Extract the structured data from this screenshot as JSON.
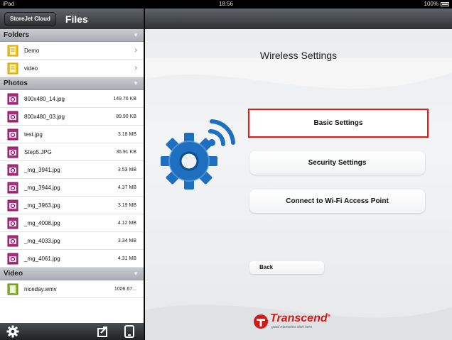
{
  "status_bar": {
    "device": "iPad",
    "time": "18:56",
    "battery": "100%"
  },
  "left_nav": {
    "back_label": "StoreJet Cloud",
    "title": "Files"
  },
  "sections": {
    "folders": "Folders",
    "photos": "Photos",
    "video": "Video"
  },
  "folders": [
    {
      "name": "Demo"
    },
    {
      "name": "video"
    }
  ],
  "photos": [
    {
      "name": "800x480_14.jpg",
      "size": "149.76 KB"
    },
    {
      "name": "800x480_03.jpg",
      "size": "89.90 KB"
    },
    {
      "name": "test.jpg",
      "size": "3.18 MB"
    },
    {
      "name": "Step5.JPG",
      "size": "36.91 KB"
    },
    {
      "name": "_mg_3941.jpg",
      "size": "3.53 MB"
    },
    {
      "name": "_mg_3944.jpg",
      "size": "4.37 MB"
    },
    {
      "name": "_mg_3963.jpg",
      "size": "3.19 MB"
    },
    {
      "name": "_mg_4008.jpg",
      "size": "4.12 MB"
    },
    {
      "name": "_mg_4033.jpg",
      "size": "3.34 MB"
    },
    {
      "name": "_mg_4061.jpg",
      "size": "4.31 MB"
    }
  ],
  "videos": [
    {
      "name": "niceday.wmv",
      "size": "1006.67..."
    }
  ],
  "toolbar_icons": [
    "gear-icon",
    "upload-icon",
    "device-icon"
  ],
  "main": {
    "title": "Wireless Settings",
    "basic_settings": "Basic Settings",
    "security_settings": "Security Settings",
    "connect_wifi": "Connect to Wi-Fi Access Point",
    "back": "Back"
  },
  "brand": {
    "name": "Transcend",
    "reg": "®",
    "tagline": "good memories start here"
  },
  "colors": {
    "selection_border": "#dd1c1c",
    "gear_blue": "#1f6fc0",
    "brand_red": "#cf1a1a",
    "folder_yellow": "#f3c21a",
    "photo_magenta": "#b0287e",
    "video_green": "#8ab526"
  }
}
